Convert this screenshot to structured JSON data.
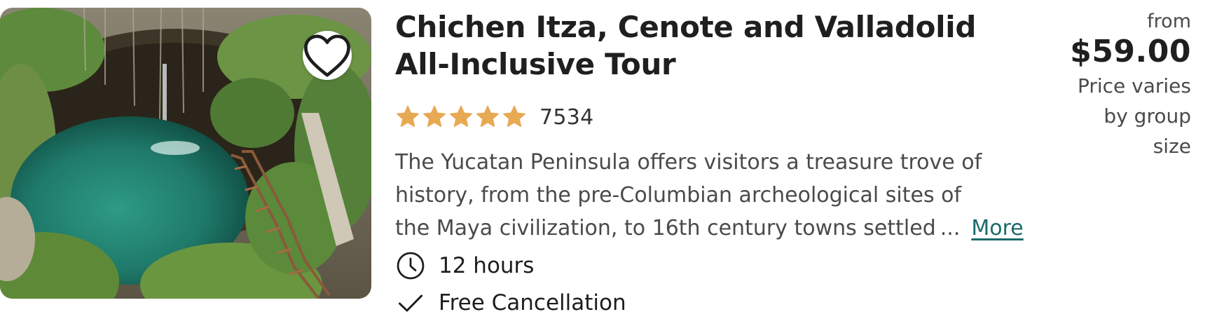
{
  "listing": {
    "title_line1": "Chichen Itza, Cenote and Valladolid",
    "title_line2": "All-Inclusive Tour",
    "rating": {
      "stars": 5,
      "review_count": "7534",
      "star_color": "#E8A953"
    },
    "description": {
      "line1": "The Yucatan Peninsula offers visitors a treasure trove of",
      "line2": "history, from the pre-Columbian archeological sites of",
      "line3": "the Maya civilization, to 16th century towns settled",
      "ellipsis": "...",
      "more_label": "More"
    },
    "features": {
      "duration": "12 hours",
      "cancellation": "Free Cancellation"
    },
    "price": {
      "from_label": "from",
      "amount": "$59.00",
      "note_line1": "Price varies",
      "note_line2": "by group",
      "note_line3": "size"
    },
    "icons": {
      "favorite": "heart-icon",
      "duration": "clock-icon",
      "cancellation": "checkmark-icon"
    },
    "colors": {
      "link": "#1A6B6A",
      "water": "#1F7A6A"
    }
  }
}
